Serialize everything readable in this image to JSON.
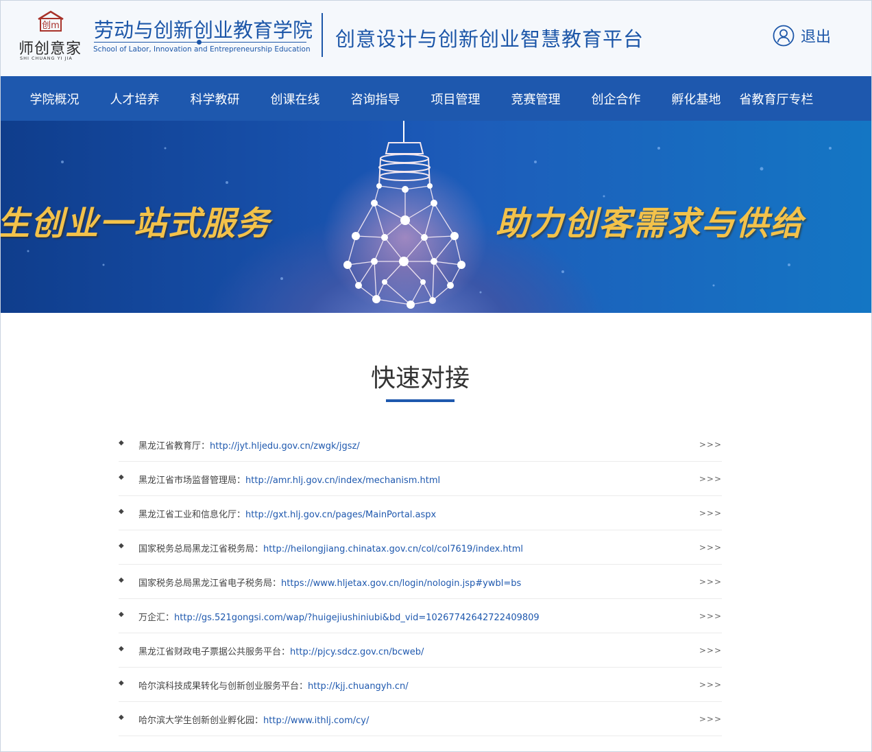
{
  "header": {
    "logo_text": "师创意家",
    "logo_pinyin": "SHI CHUANG YI JIA",
    "logo_emblem": "创m",
    "school_name_cn": "劳动与创新创业教育学院",
    "school_name_en": "School of Labor, Innovation and Entrepreneurship Education",
    "platform_title": "创意设计与创新创业智慧教育平台",
    "logout_label": "退出",
    "logout_icon": "user-icon"
  },
  "nav": {
    "items": [
      {
        "label": "学院概况"
      },
      {
        "label": "人才培养"
      },
      {
        "label": "科学教研"
      },
      {
        "label": "创课在线"
      },
      {
        "label": "咨询指导"
      },
      {
        "label": "项目管理"
      },
      {
        "label": "竞赛管理"
      },
      {
        "label": "创企合作"
      },
      {
        "label": "孵化基地"
      },
      {
        "label": "省教育厅专栏"
      }
    ]
  },
  "banner": {
    "left_text": "生创业一站式服务",
    "right_text": "助力创客需求与供给",
    "accent_color": "#f3c24a"
  },
  "section": {
    "title": "快速对接",
    "more_label": ">>>",
    "links": [
      {
        "label": "黑龙江省教育厅：",
        "url": "http://jyt.hljedu.gov.cn/zwgk/jgsz/"
      },
      {
        "label": "黑龙江省市场监督管理局：",
        "url": "http://amr.hlj.gov.cn/index/mechanism.html"
      },
      {
        "label": "黑龙江省工业和信息化厅：",
        "url": "http://gxt.hlj.gov.cn/pages/MainPortal.aspx"
      },
      {
        "label": "国家税务总局黑龙江省税务局：",
        "url": "http://heilongjiang.chinatax.gov.cn/col/col7619/index.html"
      },
      {
        "label": "国家税务总局黑龙江省电子税务局：",
        "url": "https://www.hljetax.gov.cn/login/nologin.jsp#ywbl=bs"
      },
      {
        "label": "万企汇：",
        "url": "http://gs.521gongsi.com/wap/?huigejiushiniubi&bd_vid=10267742642722409809"
      },
      {
        "label": "黑龙江省财政电子票据公共服务平台：",
        "url": "http://pjcy.sdcz.gov.cn/bcweb/"
      },
      {
        "label": "哈尔滨科技成果转化与创新创业服务平台：",
        "url": "http://kjj.chuangyh.cn/"
      },
      {
        "label": "哈尔滨大学生创新创业孵化园：",
        "url": "http://www.ithlj.com/cy/"
      }
    ]
  },
  "colors": {
    "brand_blue": "#1e58ae",
    "header_bg": "#f5f8fc",
    "banner_gold": "#f3c24a"
  }
}
